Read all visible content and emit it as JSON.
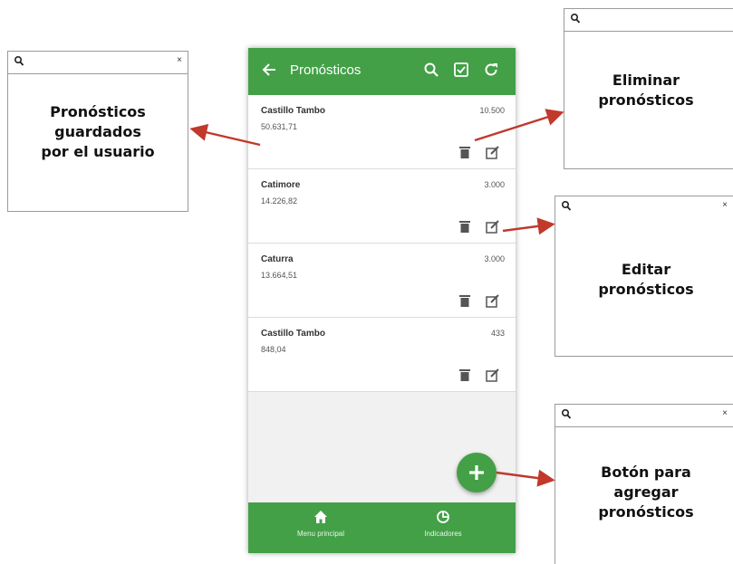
{
  "app": {
    "title": "Pronósticos",
    "actions": [
      "search-icon",
      "checkbox-icon",
      "refresh-icon"
    ],
    "accent_color": "#43a047"
  },
  "forecasts": [
    {
      "name": "Castillo Tambo",
      "value": "50.631,71",
      "qty": "10.500"
    },
    {
      "name": "Catimore",
      "value": "14.226,82",
      "qty": "3.000"
    },
    {
      "name": "Caturra",
      "value": "13.664,51",
      "qty": "3.000"
    },
    {
      "name": "Castillo Tambo",
      "value": "848,04",
      "qty": "433"
    }
  ],
  "bottom_nav": [
    {
      "label": "Menu principal",
      "icon": "home-icon"
    },
    {
      "label": "Indicadores",
      "icon": "chart-icon"
    }
  ],
  "callouts": {
    "saved": "Pronósticos\nguardados\npor el usuario",
    "delete": "Eliminar\npronósticos",
    "edit": "Editar\npronósticos",
    "add": "Botón para\nagregar\npronósticos",
    "close_symbol": "×"
  },
  "arrow_color": "#c0392b"
}
